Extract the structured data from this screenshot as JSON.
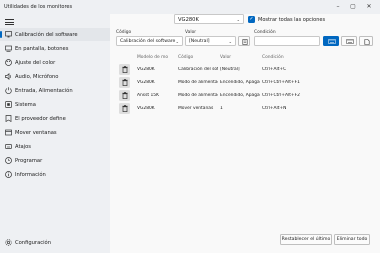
{
  "window": {
    "title": "Utilidades de los monitores",
    "minimize_icon": "minimize-icon",
    "maximize_icon": "maximize-icon",
    "close_icon": "close-icon"
  },
  "sidebar": {
    "items": [
      {
        "label": "Calibración del software",
        "icon": "calibration-icon",
        "selected": true
      },
      {
        "label": "En pantalla, botones",
        "icon": "buttons-icon"
      },
      {
        "label": "Ajuste del color",
        "icon": "color-icon"
      },
      {
        "label": "Audio, Micrófono",
        "icon": "audio-icon"
      },
      {
        "label": "Entrada, Alimentación",
        "icon": "power-icon"
      },
      {
        "label": "Sistema",
        "icon": "system-icon"
      },
      {
        "label": "El proveedor define",
        "icon": "vendor-icon"
      },
      {
        "label": "Mover ventanas",
        "icon": "window-icon"
      },
      {
        "label": "Atajos",
        "icon": "shortcut-icon"
      },
      {
        "label": "Programar",
        "icon": "schedule-icon"
      },
      {
        "label": "Información",
        "icon": "info-icon"
      }
    ],
    "settings_label": "Configuración"
  },
  "monitor_select": {
    "value": "VG280K"
  },
  "show_all": {
    "label": "Mostrar todas las opciones",
    "checked": true
  },
  "filters": {
    "code_label": "Código",
    "code_value": "Calibración del software",
    "value_label": "Valor",
    "value_value": "[Neutral]",
    "condition_label": "Condición",
    "condition_value": ""
  },
  "table": {
    "headers": [
      "Modelo de mo",
      "Código",
      "Valor",
      "Condición"
    ],
    "rows": [
      [
        "VG280K",
        "Calibración del softw",
        "[Neutral]",
        "Ctrl+Alt+C"
      ],
      [
        "VG280K",
        "Modo de alimentaci",
        "Encendido, Apagado",
        "Ctrl+Ctrl+Alt+F1"
      ],
      [
        "Ansst 15K",
        "Modo de alimentaci",
        "Encendido, Apagado",
        "Ctrl+Ctrl+Alt+F2"
      ],
      [
        "VG280K",
        "Mover ventanas",
        "1",
        "Ctrl+Alt+N"
      ]
    ]
  },
  "footer": {
    "restore_label": "Restablecer el último",
    "clear_label": "Eliminar todo"
  },
  "colors": {
    "accent": "#0067c0"
  }
}
